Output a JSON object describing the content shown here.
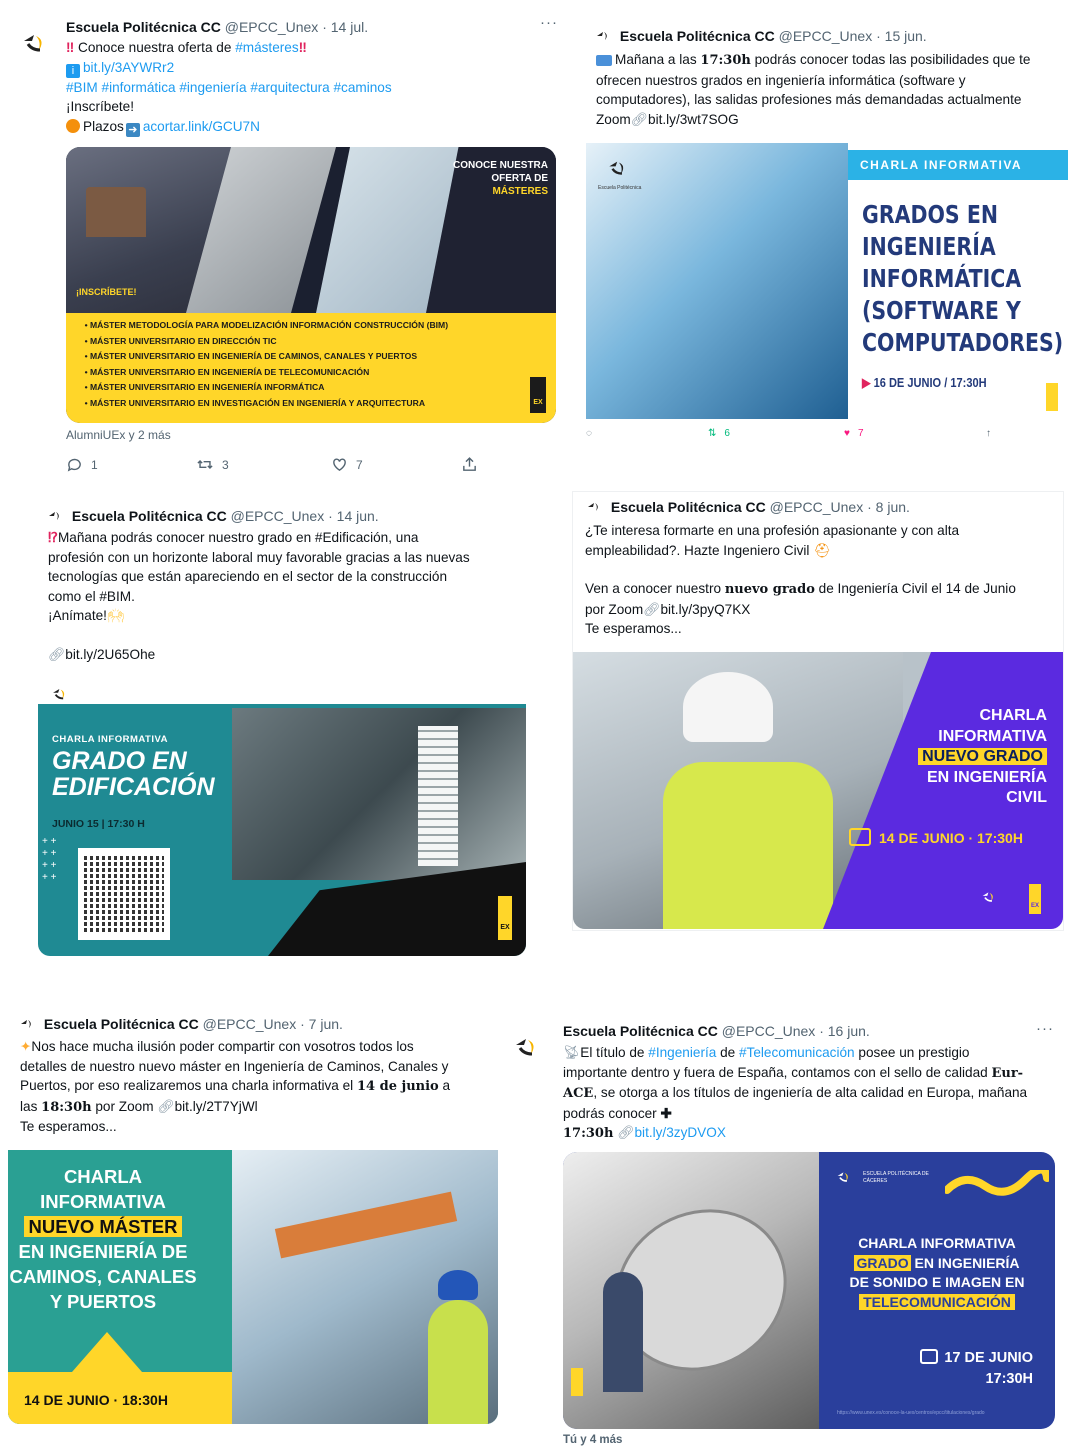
{
  "tweets": [
    {
      "name": "Escuela Politécnica CC",
      "handle": "@EPCC_Unex",
      "date": "14 jul.",
      "lines": {
        "l1": "Conoce nuestra oferta de ",
        "l1_tag": "#másteres",
        "l2_link": "bit.ly/3AYWRr2",
        "l3": "#BIM #informática #ingeniería #arquitectura #caminos",
        "l4": "¡Inscríbete!",
        "l5_a": "Plazos",
        "l5_link": "acortar.link/GCU7N"
      },
      "media": {
        "corner_l1": "CONOCE NUESTRA",
        "corner_l2": "OFERTA DE",
        "corner_l3": "MÁSTERES",
        "inscribete": "¡INSCRÍBETE!",
        "masters": [
          "MÁSTER METODOLOGÍA PARA MODELIZACIÓN INFORMACIÓN CONSTRUCCIÓN (BIM)",
          "MÁSTER UNIVERSITARIO EN DIRECCIÓN TIC",
          "MÁSTER UNIVERSITARIO EN INGENIERÍA DE CAMINOS, CANALES Y PUERTOS",
          "MÁSTER UNIVERSITARIO EN INGENIERÍA DE TELECOMUNICACIÓN",
          "MÁSTER UNIVERSITARIO EN INGENIERÍA INFORMÁTICA",
          "MÁSTER UNIVERSITARIO EN INVESTIGACIÓN EN INGENIERÍA Y ARQUITECTURA"
        ],
        "uex": "EX"
      },
      "social": "AlumniUEx y 2 más",
      "counts": {
        "reply": "1",
        "retweet": "3",
        "like": "7"
      }
    },
    {
      "name": "Escuela Politécnica CC",
      "handle": "@EPCC_Unex",
      "date": "15 jun.",
      "lines": {
        "l1_a": "Mañana a las ",
        "l1_b": "17:30h",
        "l1_c": " podrás conocer todas las posibilidades que te",
        "l2": "ofrecen nuestros grados en ingeniería informática (software y",
        "l3": "computadores), las salidas profesiones más demandadas actualmente",
        "l4_a": "Zoom",
        "l4_b": "bit.ly/3wt7SOG"
      },
      "media": {
        "banner": "CHARLA INFORMATIVA",
        "t1": "GRADOS EN",
        "t2": "INGENIERÍA",
        "t3": "INFORMÁTICA",
        "t4": "(SOFTWARE Y",
        "t5": "COMPUTADORES)",
        "date": "16 DE JUNIO / 17:30H",
        "logo_sub": "Escuela Politécnica"
      },
      "counts": {
        "retweet": "6",
        "like": "7"
      }
    },
    {
      "name": "Escuela Politécnica CC",
      "handle": "@EPCC_Unex",
      "date": "14 jun.",
      "lines": {
        "l1": "Mañana podrás conocer nuestro grado en #Edificación, una",
        "l2": "profesión con un horizonte laboral muy favorable gracias a las nuevas",
        "l3": "tecnologías que están apareciendo en el sector de la construcción",
        "l4": "como el  #BIM.",
        "l5": "¡Anímate!",
        "l6": "bit.ly/2U65Ohe"
      },
      "media": {
        "label": "CHARLA INFORMATIVA",
        "t1": "GRADO EN",
        "t2": "EDIFICACIÓN",
        "date": "JUNIO 15 | 17:30 H",
        "uex": "EX"
      }
    },
    {
      "name": "Escuela Politécnica CC",
      "handle": "@EPCC_Unex",
      "date": "8 jun.",
      "lines": {
        "l1": "¿Te interesa formarte en una profesión apasionante y con alta",
        "l2": "empleabilidad?. Hazte Ingeniero Civil",
        "l3_a": "Ven a conocer nuestro ",
        "l3_b": "nuevo grado",
        "l3_c": " de Ingeniería Civil el 14 de Junio",
        "l4_a": "por Zoom",
        "l4_b": "bit.ly/3pyQ7KX",
        "l5": "Te esperamos..."
      },
      "media": {
        "t1": "CHARLA",
        "t2": "INFORMATIVA",
        "t3": "NUEVO GRADO",
        "t4": "EN INGENIERÍA",
        "t5": "CIVIL",
        "date": "14 DE JUNIO · 17:30H",
        "uex": "EX"
      }
    },
    {
      "name": "Escuela Politécnica CC",
      "handle": "@EPCC_Unex",
      "date": "7 jun.",
      "lines": {
        "l1": "Nos hace mucha ilusión poder compartir con vosotros todos los",
        "l2": "detalles de nuestro nuevo máster en Ingeniería de Caminos, Canales y",
        "l3_a": "Puertos, por eso realizaremos una charla informativa el ",
        "l3_b": "14 de junio",
        "l3_c": " a",
        "l4_a": "las ",
        "l4_b": "18:30h",
        "l4_c": " por Zoom ",
        "l4_d": "bit.ly/2T7YjWl",
        "l5": "Te esperamos..."
      },
      "media": {
        "t1": "CHARLA",
        "t2": "INFORMATIVA",
        "t3": "NUEVO MÁSTER",
        "t4": "EN INGENIERÍA DE",
        "t5": "CAMINOS, CANALES",
        "t6": "Y PUERTOS",
        "date": "14 DE JUNIO · 18:30H"
      }
    },
    {
      "name": "Escuela Politécnica CC",
      "handle": "@EPCC_Unex",
      "date": "16 jun.",
      "lines": {
        "l1_a": "El título de ",
        "l1_b": "#Ingeniería",
        "l1_c": " de ",
        "l1_d": "#Telecomunicación",
        "l1_e": " posee un prestigio",
        "l2_a": "importante dentro y fuera de España, contamos con el sello de calidad ",
        "l2_b": "Eur-",
        "l3_a": "ACE",
        "l3_b": ", se otorga a los títulos de ingeniería de alta calidad en Europa, mañana",
        "l4": "podrás conocer",
        "l5_a": "17:30h",
        "l5_b": "bit.ly/3zyDVOX"
      },
      "media": {
        "school": "ESCUELA POLITÉCNICA DE CÁCERES",
        "t1": "CHARLA INFORMATIVA",
        "t2a": "GRADO",
        "t2b": " EN INGENIERÍA",
        "t3": "DE SONIDO E IMAGEN EN",
        "t4": "TELECOMUNICACIÓN",
        "date": "17 DE JUNIO",
        "time": "17:30H",
        "url": "https://www.unex.es/conoce-la-uex/centros/epcc/titulaciones/grado"
      },
      "social": "Tú y 4 más"
    }
  ],
  "colors": {
    "link": "#1d9bf0",
    "muted": "#536471",
    "yellow": "#ffd629",
    "teal": "#1f8a93",
    "purple": "#5b2ae0",
    "navy": "#2a3f9c"
  }
}
